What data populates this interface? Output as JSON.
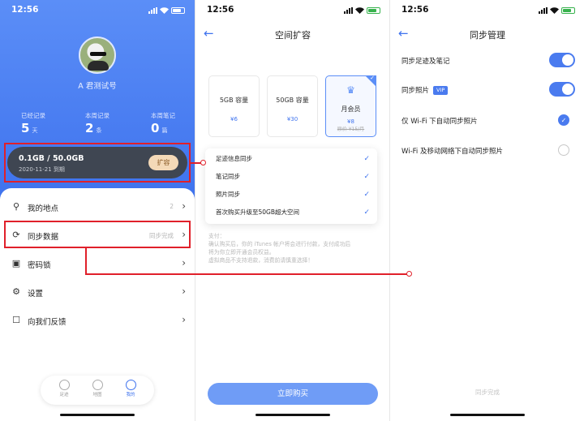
{
  "status": {
    "time": "12:56"
  },
  "screen1": {
    "username": "A 君测试号",
    "stats": [
      {
        "label": "已经记录",
        "value": "5",
        "unit": "天"
      },
      {
        "label": "本周记录",
        "value": "2",
        "unit": "条"
      },
      {
        "label": "本周笔记",
        "value": "0",
        "unit": "篇"
      }
    ],
    "storage": {
      "usage": "0.1GB / 50.0GB",
      "expiry": "2020-11-21 到期",
      "expand_label": "扩容"
    },
    "menu": [
      {
        "label": "我的地点",
        "value": "2",
        "icon": "location-pin-icon"
      },
      {
        "label": "同步数据",
        "value": "同步完成",
        "icon": "sync-icon"
      },
      {
        "label": "密码锁",
        "value": "",
        "icon": "lock-icon"
      },
      {
        "label": "设置",
        "value": "",
        "icon": "gear-icon"
      },
      {
        "label": "向我们反馈",
        "value": "",
        "icon": "feedback-icon"
      }
    ],
    "tabs": [
      {
        "label": "足迹",
        "icon": "footprint-icon"
      },
      {
        "label": "地图",
        "icon": "globe-icon"
      },
      {
        "label": "我的",
        "icon": "profile-icon"
      }
    ]
  },
  "screen2": {
    "title": "空间扩容",
    "plans": [
      {
        "name": "5GB 容量",
        "price": "¥6"
      },
      {
        "name": "50GB 容量",
        "price": "¥30"
      },
      {
        "name": "月会员",
        "price": "¥8",
        "original_price": "原价 ¥15/月"
      }
    ],
    "features": [
      "足迹信息同步",
      "笔记同步",
      "照片同步",
      "首次购买升级至50GB超大空间"
    ],
    "pay_note": [
      "支付：",
      "确认购买后，你的 iTunes 帐户将会进行付款，支付成功后",
      "将为你立即开通会员权益。",
      "虚拟商品不支持退款，消费前请慎重选择！"
    ],
    "buy_label": "立即购买"
  },
  "screen3": {
    "title": "同步管理",
    "settings": [
      {
        "label": "同步足迹及笔记",
        "control": "toggle",
        "on": true
      },
      {
        "label": "同步照片",
        "badge": "VIP",
        "control": "toggle",
        "on": true
      },
      {
        "label": "仅 Wi-Fi 下自动同步照片",
        "control": "radio",
        "on": true
      },
      {
        "label": "Wi-Fi 及移动网络下自动同步照片",
        "control": "radio",
        "on": false
      }
    ],
    "footer": "同步完成"
  },
  "colors": {
    "accent": "#4a7bef",
    "annotation": "#e0202a",
    "storage_card": "#3f4652",
    "expand_button": "#f4d9b8"
  }
}
